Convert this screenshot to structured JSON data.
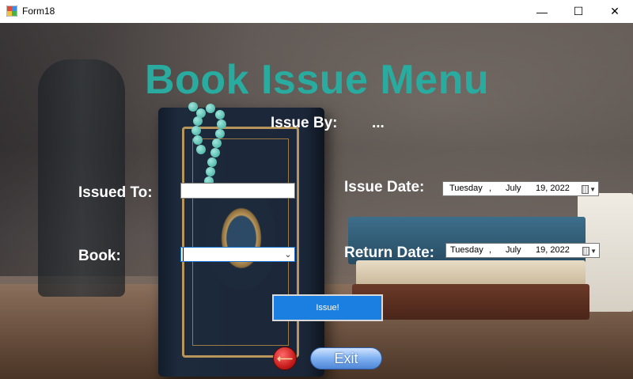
{
  "window": {
    "title": "Form18",
    "icon": "windows-form-icon",
    "controls": {
      "minimize": "—",
      "maximize": "☐",
      "close": "✕"
    }
  },
  "form": {
    "heading": "Book Issue Menu",
    "issue_by": {
      "label": "Issue By:",
      "value": "..."
    },
    "issued_to": {
      "label": "Issued To:",
      "value": ""
    },
    "book": {
      "label": "Book:",
      "selected": ""
    },
    "issue_date": {
      "label": "Issue Date:",
      "day": "Tuesday",
      "sep": ",",
      "month": "July",
      "daynum_year": "19, 2022"
    },
    "return_date": {
      "label": "Return Date:",
      "day": "Tuesday",
      "sep": ",",
      "month": "July",
      "daynum_year": "19, 2022"
    },
    "issue_button": "Issue!",
    "exit_button": "Exit",
    "back_icon": "back-arrow-icon"
  },
  "colors": {
    "heading": "#29aba0",
    "issue_button_bg": "#1a7fe0",
    "label_text": "#ffffff"
  }
}
